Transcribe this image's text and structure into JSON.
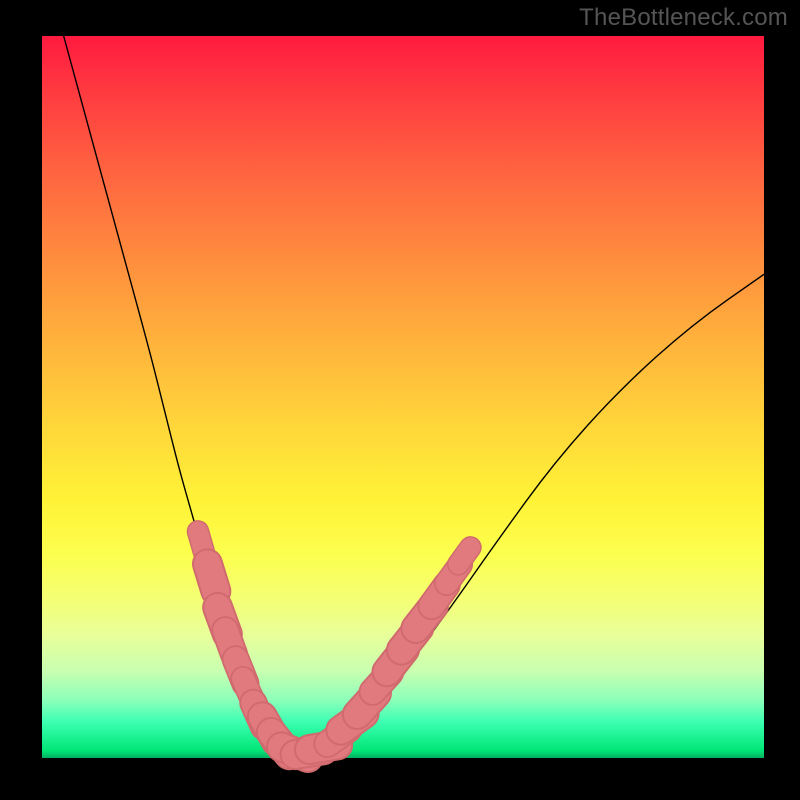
{
  "watermark": "TheBottleneck.com",
  "colors": {
    "black": "#000000",
    "curve": "#000000",
    "marker_fill": "#e07a7e",
    "marker_stroke": "#d06a6e"
  },
  "chart_data": {
    "type": "line",
    "title": "",
    "xlabel": "",
    "ylabel": "",
    "xlim": [
      0,
      100
    ],
    "ylim": [
      0,
      100
    ],
    "series": [
      {
        "name": "bottleneck-curve",
        "x": [
          3,
          6,
          9,
          12,
          15,
          17,
          19,
          21,
          23,
          25,
          27,
          29,
          31,
          33,
          35,
          38,
          41,
          45,
          50,
          56,
          63,
          71,
          80,
          90,
          100
        ],
        "y": [
          100,
          89,
          78,
          67,
          56,
          48,
          40,
          33,
          26,
          20,
          15,
          10,
          6,
          3,
          1,
          1,
          2,
          6,
          12,
          20,
          30,
          41,
          51,
          60,
          67
        ]
      }
    ],
    "markers": [
      {
        "x": 22,
        "y": 30.0,
        "r": 1.6
      },
      {
        "x": 23.5,
        "y": 25.0,
        "r": 2.2
      },
      {
        "x": 25.0,
        "y": 19.0,
        "r": 2.2
      },
      {
        "x": 26.0,
        "y": 16.0,
        "r": 2.0
      },
      {
        "x": 27.5,
        "y": 12.0,
        "r": 2.0
      },
      {
        "x": 28.5,
        "y": 9.5,
        "r": 1.8
      },
      {
        "x": 30.0,
        "y": 6.0,
        "r": 2.0
      },
      {
        "x": 31.5,
        "y": 4.0,
        "r": 2.2
      },
      {
        "x": 33.0,
        "y": 2.0,
        "r": 2.2
      },
      {
        "x": 35.0,
        "y": 0.8,
        "r": 2.2
      },
      {
        "x": 37.0,
        "y": 0.8,
        "r": 2.2
      },
      {
        "x": 39.0,
        "y": 1.5,
        "r": 2.2
      },
      {
        "x": 41.0,
        "y": 3.0,
        "r": 2.0
      },
      {
        "x": 43.0,
        "y": 5.0,
        "r": 2.2
      },
      {
        "x": 45.0,
        "y": 7.5,
        "r": 2.2
      },
      {
        "x": 47.0,
        "y": 10.5,
        "r": 2.0
      },
      {
        "x": 49.0,
        "y": 13.5,
        "r": 2.2
      },
      {
        "x": 51.0,
        "y": 16.5,
        "r": 2.2
      },
      {
        "x": 53.0,
        "y": 19.5,
        "r": 2.2
      },
      {
        "x": 55.0,
        "y": 22.5,
        "r": 2.0
      },
      {
        "x": 57.0,
        "y": 25.5,
        "r": 1.8
      },
      {
        "x": 58.5,
        "y": 28.0,
        "r": 1.6
      }
    ]
  }
}
